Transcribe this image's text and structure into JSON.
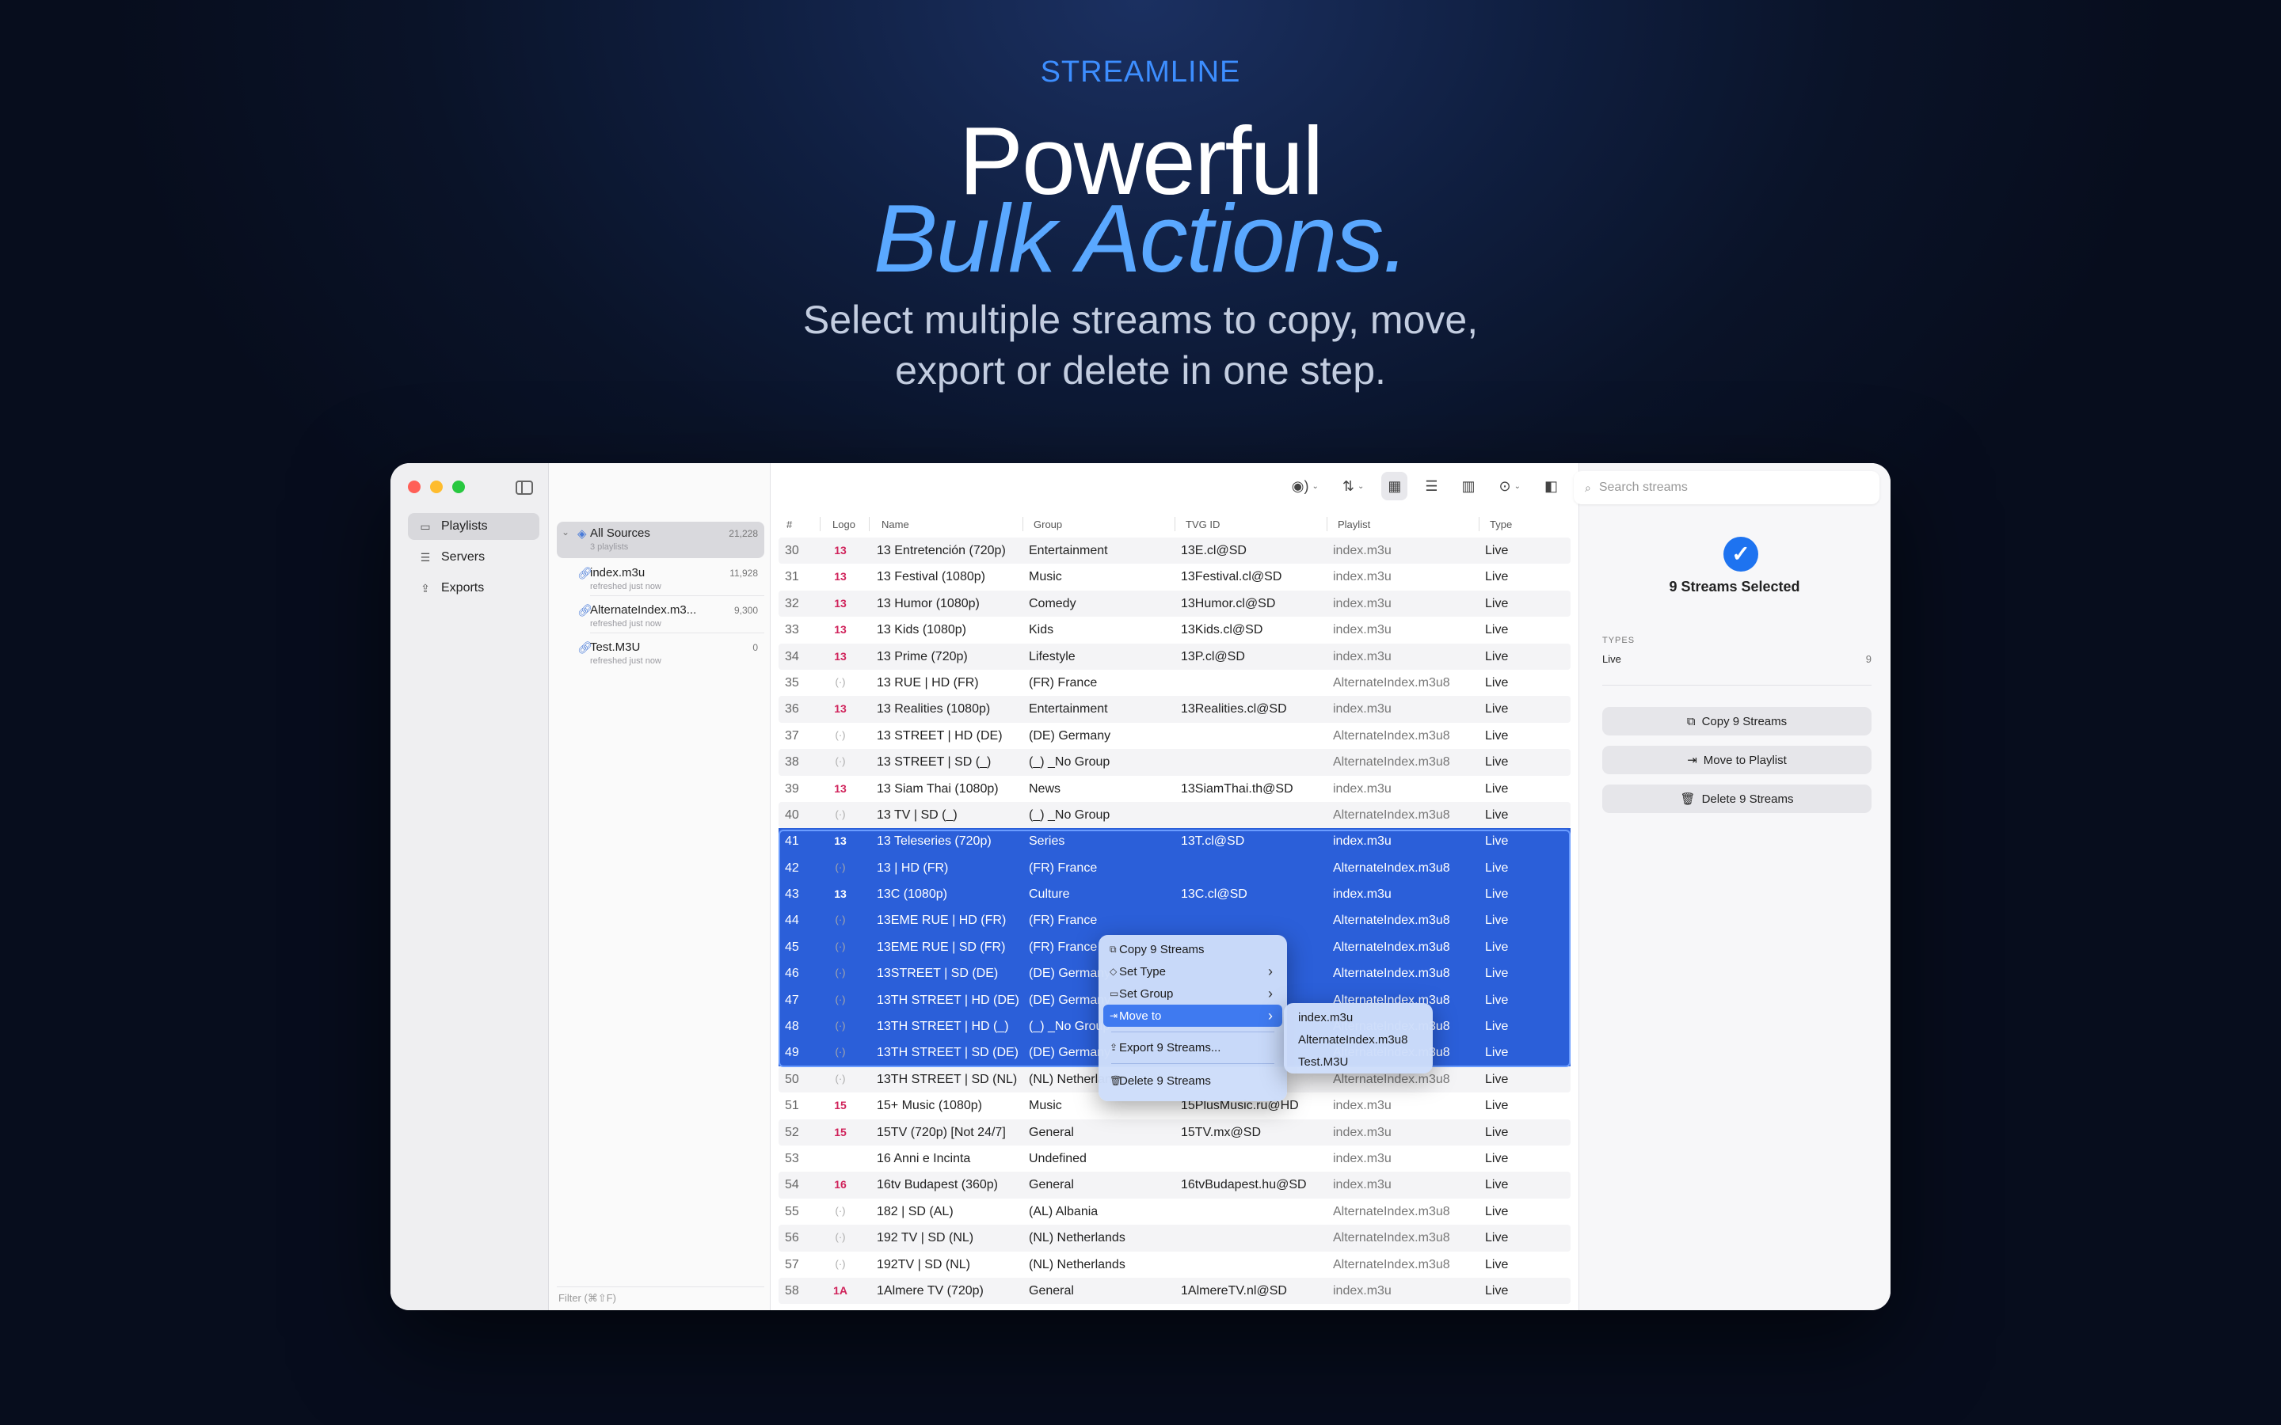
{
  "hero": {
    "eyebrow": "STREAMLINE",
    "line1": "Powerful",
    "line2": "Bulk Actions",
    "line2_dot": ".",
    "subtitle_1": "Select multiple streams to copy, move,",
    "subtitle_2": "export or delete in one step."
  },
  "sidebar": {
    "items": [
      {
        "label": "Playlists",
        "icon": "monitor-icon"
      },
      {
        "label": "Servers",
        "icon": "server-icon"
      },
      {
        "label": "Exports",
        "icon": "export-icon"
      }
    ]
  },
  "sources": [
    {
      "name": "All Sources",
      "count": "21,228",
      "meta": "3 playlists"
    },
    {
      "name": "index.m3u",
      "count": "11,928",
      "meta": "refreshed just now"
    },
    {
      "name": "AlternateIndex.m3...",
      "count": "9,300",
      "meta": "refreshed just now"
    },
    {
      "name": "Test.M3U",
      "count": "0",
      "meta": "refreshed just now"
    }
  ],
  "filter_placeholder": "Filter (⌘⇧F)",
  "search_placeholder": "Search streams",
  "columns": {
    "num": "#",
    "logo": "Logo",
    "name": "Name",
    "group": "Group",
    "tvg": "TVG ID",
    "playlist": "Playlist",
    "type": "Type"
  },
  "rows": [
    {
      "n": "30",
      "name": "13 Entretención (720p)",
      "group": "Entertainment",
      "tvg": "13E.cl@SD",
      "playlist": "index.m3u",
      "type": "Live",
      "logo": "13"
    },
    {
      "n": "31",
      "name": "13 Festival (1080p)",
      "group": "Music",
      "tvg": "13Festival.cl@SD",
      "playlist": "index.m3u",
      "type": "Live",
      "logo": "13"
    },
    {
      "n": "32",
      "name": "13 Humor (1080p)",
      "group": "Comedy",
      "tvg": "13Humor.cl@SD",
      "playlist": "index.m3u",
      "type": "Live",
      "logo": "13"
    },
    {
      "n": "33",
      "name": "13 Kids (1080p)",
      "group": "Kids",
      "tvg": "13Kids.cl@SD",
      "playlist": "index.m3u",
      "type": "Live",
      "logo": "13"
    },
    {
      "n": "34",
      "name": "13 Prime (720p)",
      "group": "Lifestyle",
      "tvg": "13P.cl@SD",
      "playlist": "index.m3u",
      "type": "Live",
      "logo": "13"
    },
    {
      "n": "35",
      "name": "13 RUE | HD (FR)",
      "group": "(FR) France",
      "tvg": "",
      "playlist": "AlternateIndex.m3u8",
      "type": "Live",
      "logo": "(·)"
    },
    {
      "n": "36",
      "name": "13 Realities (1080p)",
      "group": "Entertainment",
      "tvg": "13Realities.cl@SD",
      "playlist": "index.m3u",
      "type": "Live",
      "logo": "13"
    },
    {
      "n": "37",
      "name": "13 STREET | HD (DE)",
      "group": "(DE) Germany",
      "tvg": "",
      "playlist": "AlternateIndex.m3u8",
      "type": "Live",
      "logo": "(·)"
    },
    {
      "n": "38",
      "name": "13 STREET | SD (_)",
      "group": "(_) _No Group",
      "tvg": "",
      "playlist": "AlternateIndex.m3u8",
      "type": "Live",
      "logo": "(·)"
    },
    {
      "n": "39",
      "name": "13 Siam Thai (1080p)",
      "group": "News",
      "tvg": "13SiamThai.th@SD",
      "playlist": "index.m3u",
      "type": "Live",
      "logo": "13"
    },
    {
      "n": "40",
      "name": "13 TV | SD (_)",
      "group": "(_) _No Group",
      "tvg": "",
      "playlist": "AlternateIndex.m3u8",
      "type": "Live",
      "logo": "(·)"
    },
    {
      "n": "41",
      "name": "13 Teleseries (720p)",
      "group": "Series",
      "tvg": "13T.cl@SD",
      "playlist": "index.m3u",
      "type": "Live",
      "logo": "13"
    },
    {
      "n": "42",
      "name": "13 | HD (FR)",
      "group": "(FR) France",
      "tvg": "",
      "playlist": "AlternateIndex.m3u8",
      "type": "Live",
      "logo": "(·)"
    },
    {
      "n": "43",
      "name": "13C (1080p)",
      "group": "Culture",
      "tvg": "13C.cl@SD",
      "playlist": "index.m3u",
      "type": "Live",
      "logo": "13"
    },
    {
      "n": "44",
      "name": "13EME RUE | HD (FR)",
      "group": "(FR) France",
      "tvg": "",
      "playlist": "AlternateIndex.m3u8",
      "type": "Live",
      "logo": "(·)"
    },
    {
      "n": "45",
      "name": "13EME RUE | SD (FR)",
      "group": "(FR) France",
      "tvg": "",
      "playlist": "AlternateIndex.m3u8",
      "type": "Live",
      "logo": "(·)"
    },
    {
      "n": "46",
      "name": "13STREET | SD (DE)",
      "group": "(DE) Germany",
      "tvg": "",
      "playlist": "AlternateIndex.m3u8",
      "type": "Live",
      "logo": "(·)"
    },
    {
      "n": "47",
      "name": "13TH STREET | HD (DE)",
      "group": "(DE) Germany",
      "tvg": "",
      "playlist": "AlternateIndex.m3u8",
      "type": "Live",
      "logo": "(·)"
    },
    {
      "n": "48",
      "name": "13TH STREET | HD (_)",
      "group": "(_) _No Group",
      "tvg": "",
      "playlist": "AlternateIndex.m3u8",
      "type": "Live",
      "logo": "(·)"
    },
    {
      "n": "49",
      "name": "13TH STREET | SD (DE)",
      "group": "(DE) Germany",
      "tvg": "",
      "playlist": "AlternateIndex.m3u8",
      "type": "Live",
      "logo": "(·)"
    },
    {
      "n": "50",
      "name": "13TH STREET | SD (NL)",
      "group": "(NL) Netherlands",
      "tvg": "",
      "playlist": "AlternateIndex.m3u8",
      "type": "Live",
      "logo": "(·)"
    },
    {
      "n": "51",
      "name": "15+ Music (1080p)",
      "group": "Music",
      "tvg": "15PlusMusic.ru@HD",
      "playlist": "index.m3u",
      "type": "Live",
      "logo": "15"
    },
    {
      "n": "52",
      "name": "15TV (720p) [Not 24/7]",
      "group": "General",
      "tvg": "15TV.mx@SD",
      "playlist": "index.m3u",
      "type": "Live",
      "logo": "15"
    },
    {
      "n": "53",
      "name": "16 Anni e Incinta",
      "group": "Undefined",
      "tvg": "",
      "playlist": "index.m3u",
      "type": "Live",
      "logo": ""
    },
    {
      "n": "54",
      "name": "16tv Budapest (360p)",
      "group": "General",
      "tvg": "16tvBudapest.hu@SD",
      "playlist": "index.m3u",
      "type": "Live",
      "logo": "16"
    },
    {
      "n": "55",
      "name": "182 | SD (AL)",
      "group": "(AL) Albania",
      "tvg": "",
      "playlist": "AlternateIndex.m3u8",
      "type": "Live",
      "logo": "(·)"
    },
    {
      "n": "56",
      "name": "192 TV | SD (NL)",
      "group": "(NL) Netherlands",
      "tvg": "",
      "playlist": "AlternateIndex.m3u8",
      "type": "Live",
      "logo": "(·)"
    },
    {
      "n": "57",
      "name": "192TV | SD (NL)",
      "group": "(NL) Netherlands",
      "tvg": "",
      "playlist": "AlternateIndex.m3u8",
      "type": "Live",
      "logo": "(·)"
    },
    {
      "n": "58",
      "name": "1Almere TV (720p)",
      "group": "General",
      "tvg": "1AlmereTV.nl@SD",
      "playlist": "index.m3u",
      "type": "Live",
      "logo": "1A"
    }
  ],
  "selected_rows": [
    "41",
    "42",
    "43",
    "44",
    "45",
    "46",
    "47",
    "48",
    "49"
  ],
  "context_menu": {
    "copy": "Copy 9 Streams",
    "set_type": "Set Type",
    "set_group": "Set Group",
    "move_to": "Move to",
    "export": "Export 9 Streams...",
    "delete": "Delete 9 Streams"
  },
  "submenu": [
    "index.m3u",
    "AlternateIndex.m3u8",
    "Test.M3U"
  ],
  "inspector": {
    "title": "9 Streams Selected",
    "types_label": "TYPES",
    "type_name": "Live",
    "type_count": "9",
    "copy": "Copy 9 Streams",
    "move": "Move to Playlist",
    "delete": "Delete 9 Streams"
  },
  "colors": {
    "accent": "#1e73f0",
    "selection": "#2b5fd9",
    "hero_blue": "#5aa8ff"
  }
}
